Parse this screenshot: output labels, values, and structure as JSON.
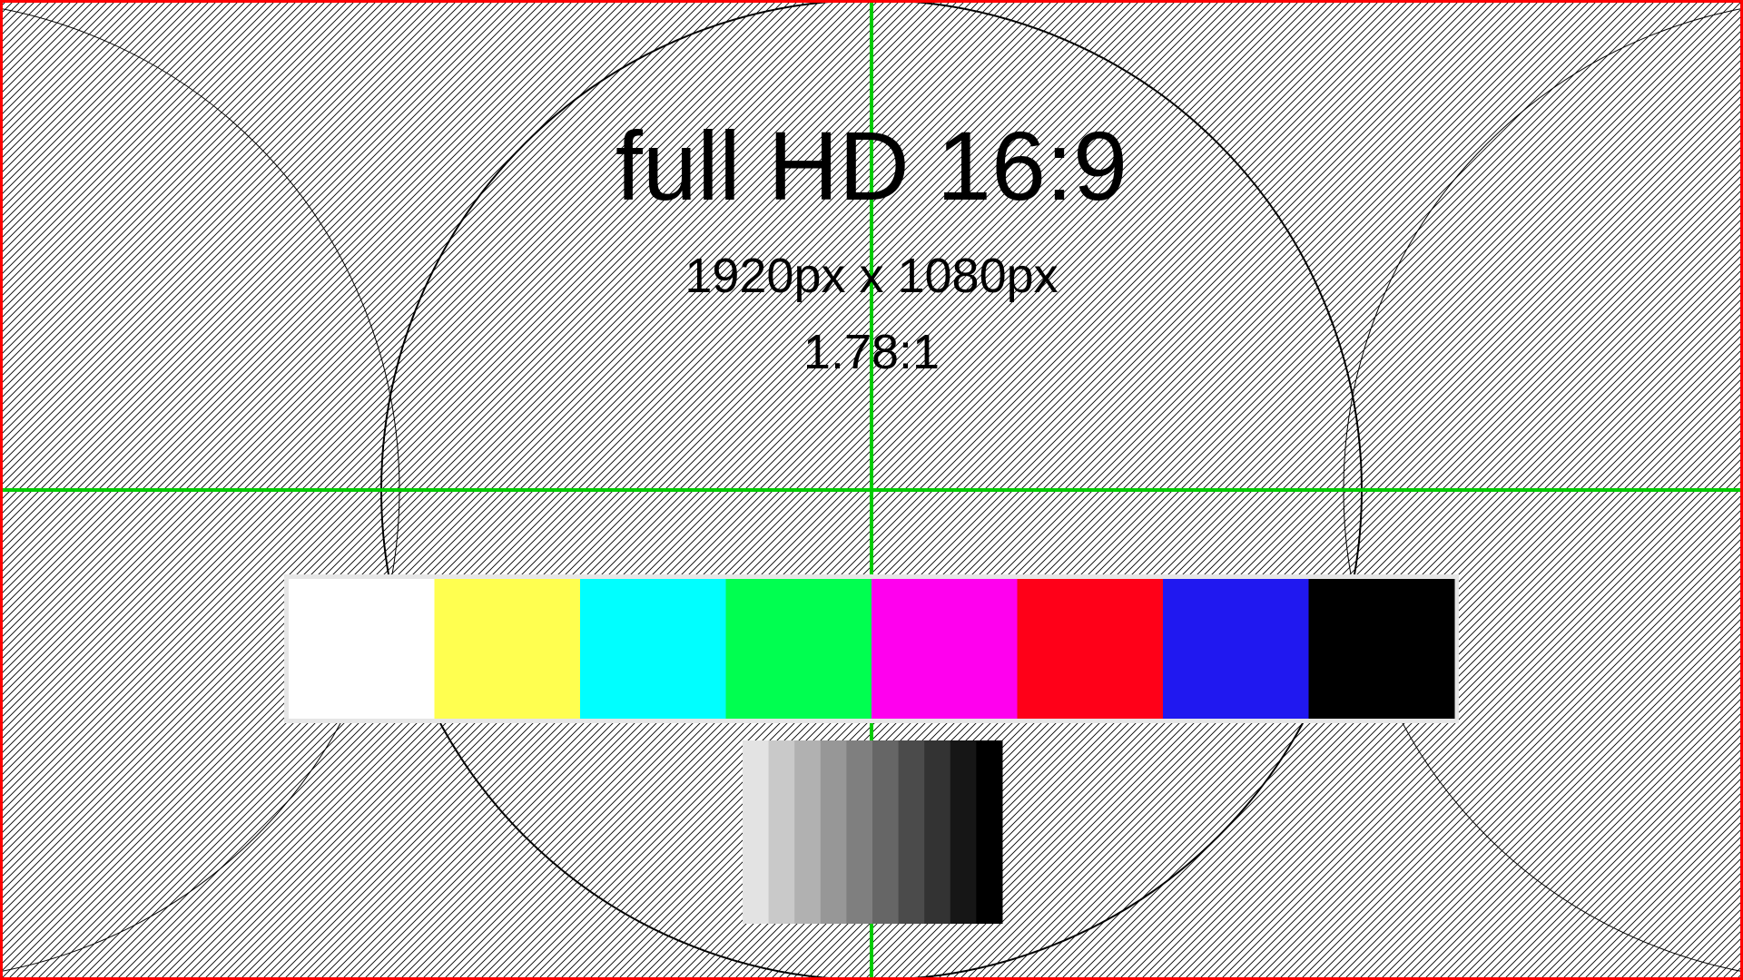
{
  "title": "full HD 16:9",
  "resolution": "1920px x 1080px",
  "aspect_ratio": "1.78:1",
  "colors": {
    "border": "#ff0000",
    "crosshair": "#00cc00",
    "hatch": "#000000",
    "background": "#ffffff"
  },
  "color_bars": [
    {
      "name": "white",
      "color": "#ffffff"
    },
    {
      "name": "yellow",
      "color": "#ffff50"
    },
    {
      "name": "cyan",
      "color": "#00ffff"
    },
    {
      "name": "green",
      "color": "#00ff50"
    },
    {
      "name": "magenta",
      "color": "#ff00ee"
    },
    {
      "name": "red",
      "color": "#ff0018"
    },
    {
      "name": "blue",
      "color": "#2018f0"
    },
    {
      "name": "black",
      "color": "#000000"
    }
  ],
  "grayscale_bars": [
    {
      "name": "gray-10",
      "color": "#e3e3e3"
    },
    {
      "name": "gray-20",
      "color": "#c9c9c9"
    },
    {
      "name": "gray-30",
      "color": "#b1b1b1"
    },
    {
      "name": "gray-40",
      "color": "#979797"
    },
    {
      "name": "gray-50",
      "color": "#7f7f7f"
    },
    {
      "name": "gray-60",
      "color": "#666666"
    },
    {
      "name": "gray-70",
      "color": "#4b4b4b"
    },
    {
      "name": "gray-80",
      "color": "#333333"
    },
    {
      "name": "gray-90",
      "color": "#161616"
    },
    {
      "name": "gray-100",
      "color": "#000000"
    }
  ]
}
